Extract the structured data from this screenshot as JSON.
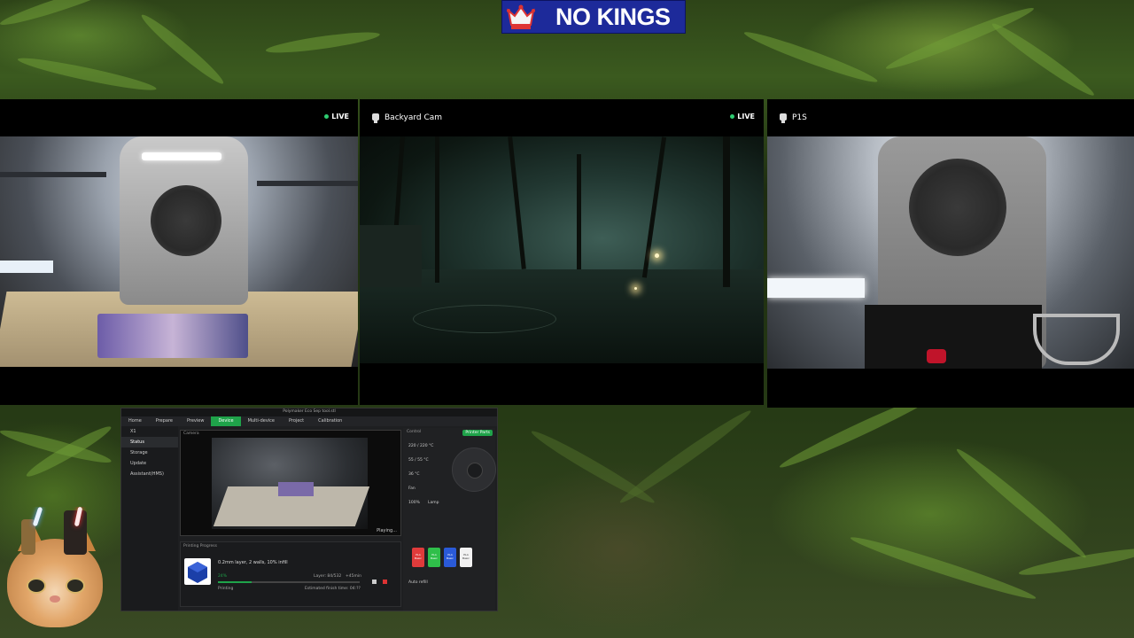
{
  "brand": {
    "logo_text": "NO KINGS",
    "logo_bg": "#1d2a9a"
  },
  "cameras": [
    {
      "name": "",
      "live_label": "LIVE",
      "has_icon": false
    },
    {
      "name": "Backyard Cam",
      "live_label": "LIVE",
      "has_icon": true
    },
    {
      "name": "P1S",
      "live_label": "",
      "has_icon": true
    }
  ],
  "app": {
    "window_title": "Polymaker Eco Sep tool.stl",
    "tabs": [
      "Home",
      "Prepare",
      "Preview",
      "Device",
      "Multi-device",
      "Project",
      "Calibration"
    ],
    "active_tab": "Device",
    "sidebar": [
      "X1",
      "Status",
      "Storage",
      "Update",
      "Assistant(HMS)"
    ],
    "active_side": "Status",
    "video_status": "Playing...",
    "camera_label": "Camera",
    "control_label": "Control",
    "printer_parts_label": "Printer Parts",
    "temps": [
      "220 / 220 °C",
      "55 / 55 °C",
      "36 °C"
    ],
    "fan_label": "Fan",
    "fan_values": [
      "100%",
      "Lamp"
    ],
    "spools": [
      {
        "label": "PLA Basic",
        "color": "#e03b3b"
      },
      {
        "label": "PLA Basic",
        "color": "#2fbf4a"
      },
      {
        "label": "PLA Basic",
        "color": "#2a5ad8"
      },
      {
        "label": "PLA Basic",
        "color": "#f2f2f2"
      }
    ],
    "ams_label": "Auto refill",
    "print_progress_label": "Printing Progress",
    "job_desc": "0.2mm layer, 2 walls, 10% infill",
    "progress_pct": "24%",
    "layer_text": "Layer: 84/532",
    "time_left": "+45min",
    "est_finish": "Estimated finish time: 04:??",
    "print_status": "Printing",
    "progress_fraction": 0.24
  }
}
